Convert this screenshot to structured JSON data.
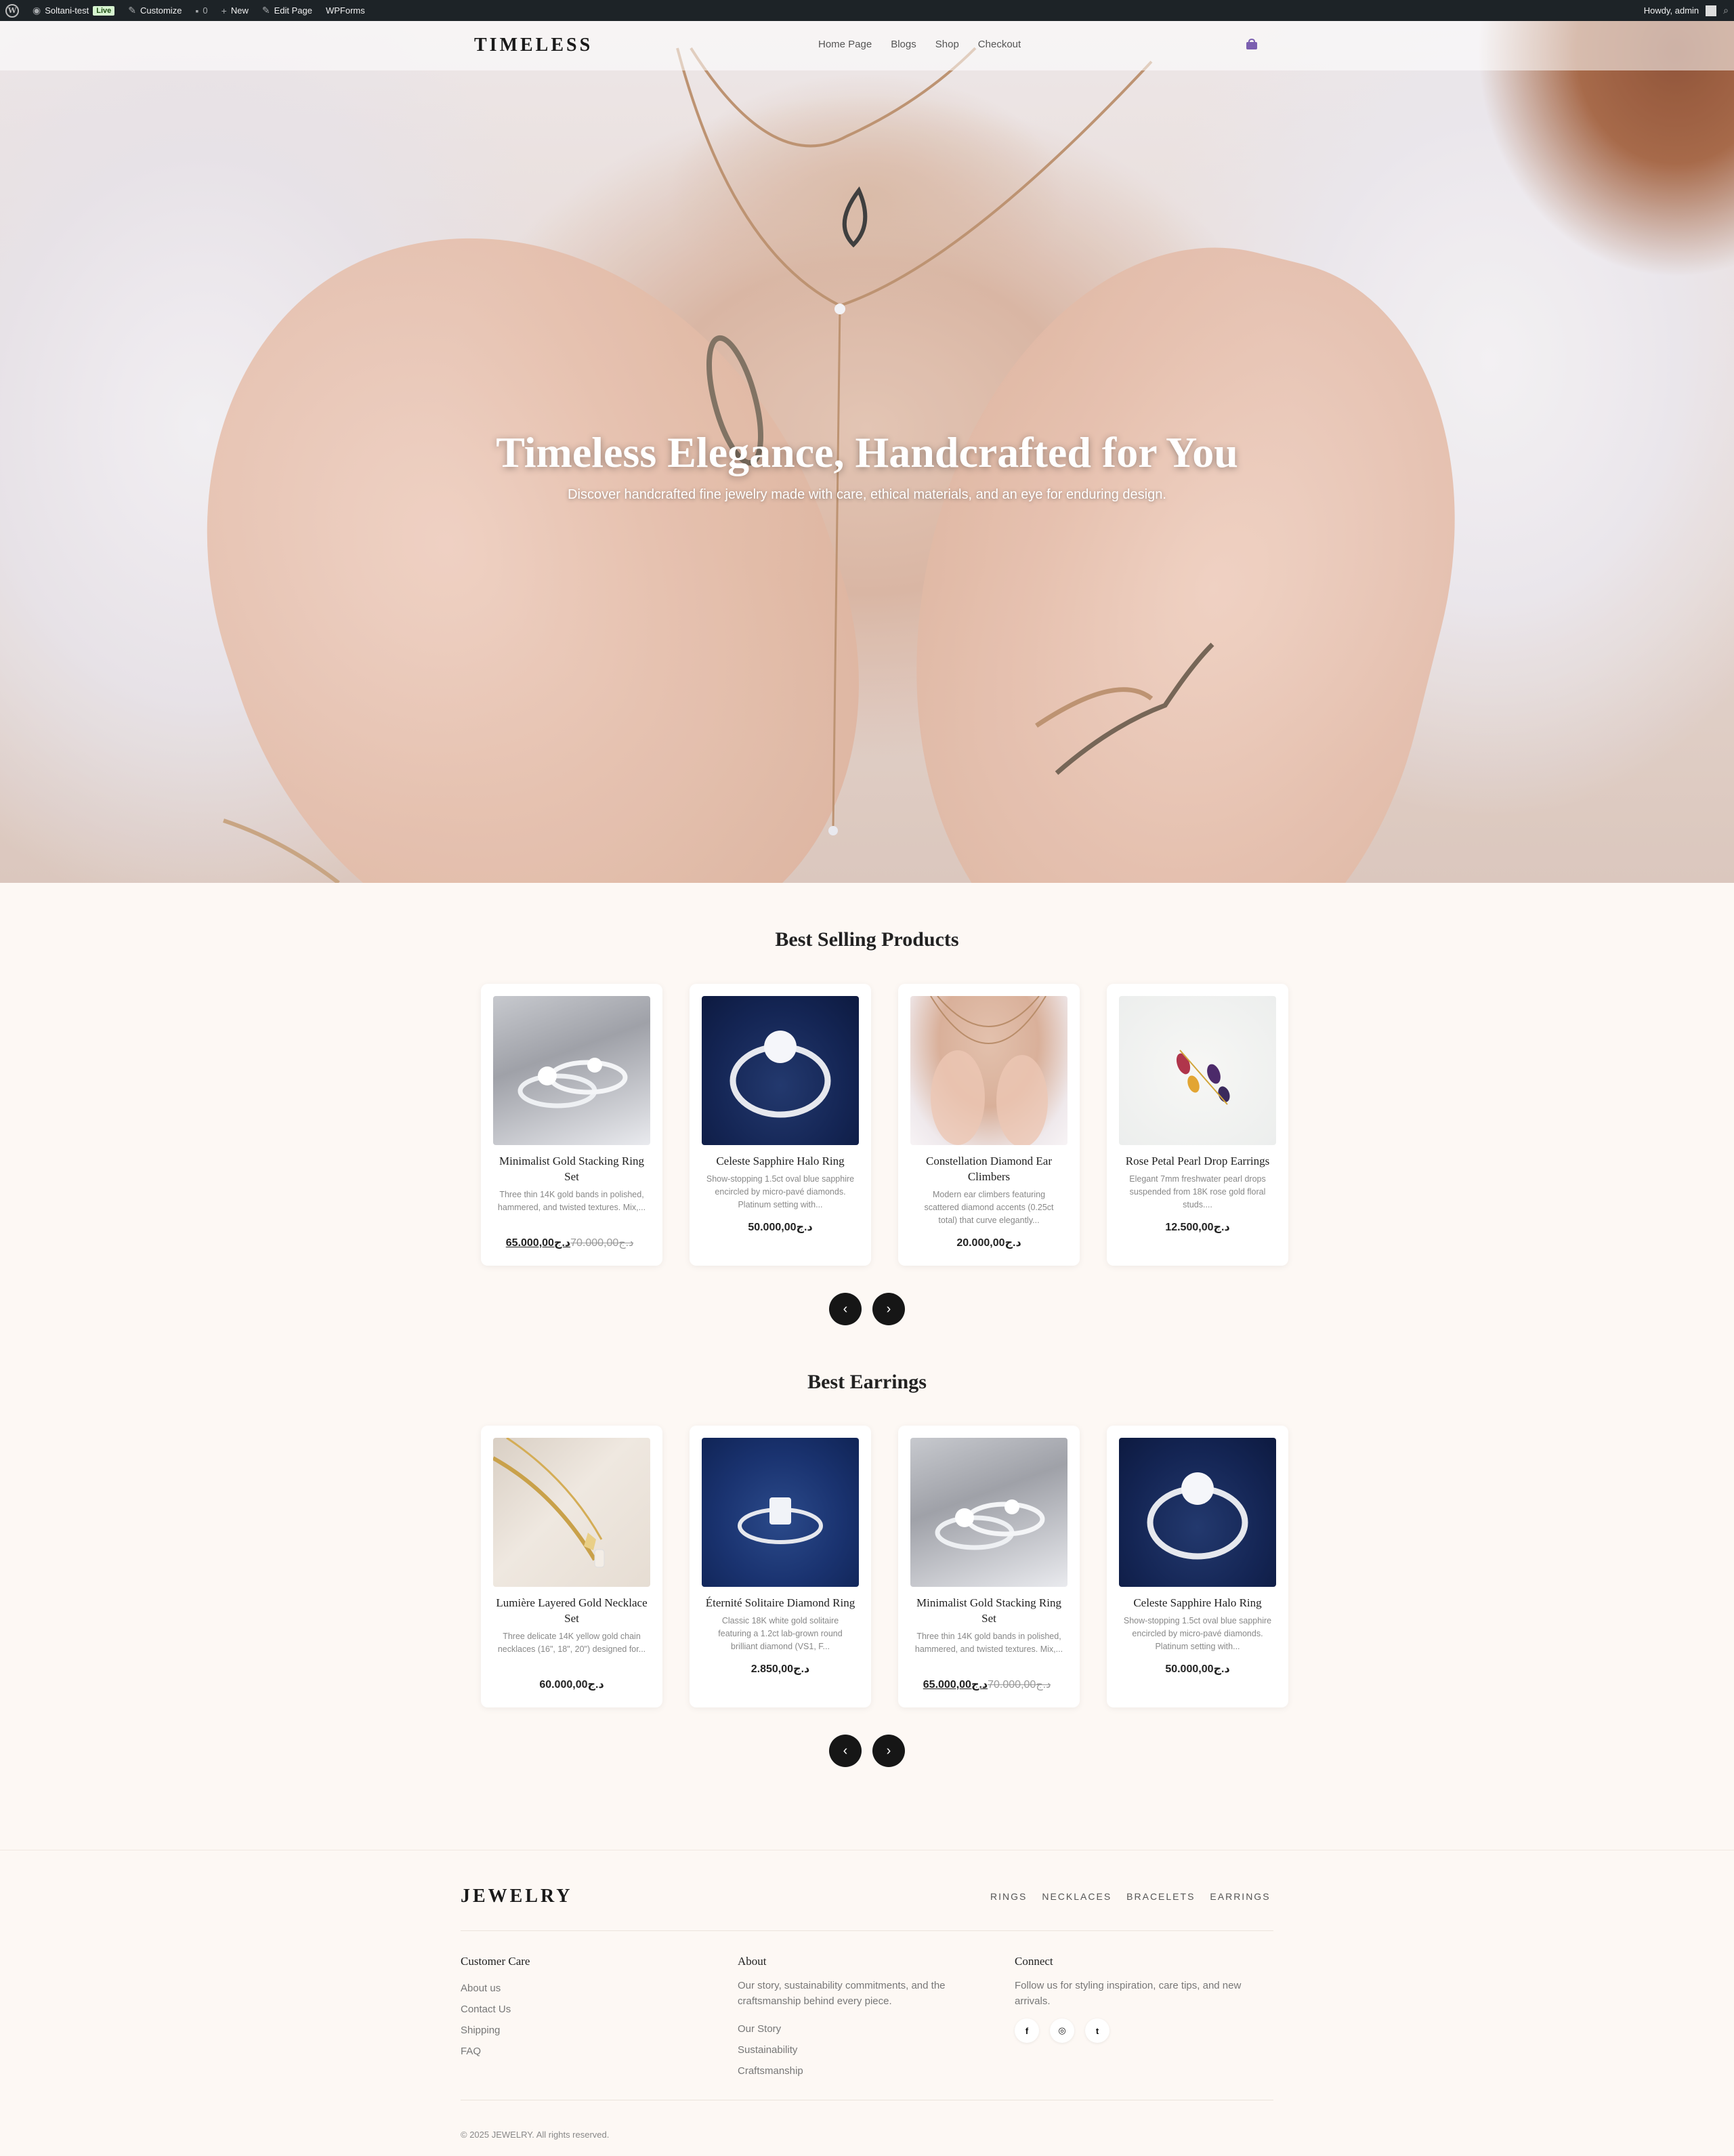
{
  "admin_bar": {
    "site_name": "Soltani-test",
    "live_badge": "Live",
    "customize": "Customize",
    "comments_count": "0",
    "new": "New",
    "edit_page": "Edit Page",
    "wpforms": "WPForms",
    "howdy": "Howdy, admin"
  },
  "header": {
    "logo": "TIMELESS",
    "nav": [
      "Home Page",
      "Blogs",
      "Shop",
      "Checkout"
    ]
  },
  "hero": {
    "title": "Timeless Elegance, Handcrafted for You",
    "subtitle": "Discover handcrafted fine jewelry made with care, ethical materials, and an eye for enduring design."
  },
  "best_selling": {
    "title": "Best Selling Products",
    "products": [
      {
        "name": "Minimalist Gold Stacking Ring Set",
        "desc": "Three thin 14K gold bands in polished, hammered, and twisted textures. Mix,...",
        "old_price": "د.ج70.000,00",
        "price": "د.ج65.000,00"
      },
      {
        "name": "Celeste Sapphire Halo Ring",
        "desc": "Show-stopping 1.5ct oval blue sapphire encircled by micro-pavé diamonds. Platinum setting with...",
        "old_price": "",
        "price": "د.ج50.000,00"
      },
      {
        "name": "Constellation Diamond Ear Climbers",
        "desc": "Modern ear climbers featuring scattered diamond accents (0.25ct total) that curve elegantly...",
        "old_price": "",
        "price": "د.ج20.000,00"
      },
      {
        "name": "Rose Petal Pearl Drop Earrings",
        "desc": "Elegant 7mm freshwater pearl drops suspended from 18K rose gold floral studs....",
        "old_price": "",
        "price": "د.ج12.500,00"
      }
    ]
  },
  "best_earrings": {
    "title": "Best Earrings",
    "products": [
      {
        "name": "Lumière Layered Gold Necklace Set",
        "desc": "Three delicate 14K yellow gold chain necklaces (16\", 18\", 20\") designed for...",
        "old_price": "",
        "price": "د.ج60.000,00"
      },
      {
        "name": "Éternité Solitaire Diamond Ring",
        "desc": "Classic 18K white gold solitaire featuring a 1.2ct lab-grown round brilliant diamond (VS1, F...",
        "old_price": "",
        "price": "د.ج2.850,00"
      },
      {
        "name": "Minimalist Gold Stacking Ring Set",
        "desc": "Three thin 14K gold bands in polished, hammered, and twisted textures. Mix,...",
        "old_price": "د.ج70.000,00",
        "price": "د.ج65.000,00"
      },
      {
        "name": "Celeste Sapphire Halo Ring",
        "desc": "Show-stopping 1.5ct oval blue sapphire encircled by micro-pavé diamonds. Platinum setting with...",
        "old_price": "",
        "price": "د.ج50.000,00"
      }
    ]
  },
  "carousel": {
    "prev": "‹",
    "next": "›"
  },
  "footer": {
    "logo": "JEWELRY",
    "nav": [
      "RINGS",
      "NECKLACES",
      "BRACELETS",
      "EARRINGS"
    ],
    "customer_care": {
      "title": "Customer Care",
      "links": [
        "About us",
        "Contact Us",
        "Shipping",
        "FAQ"
      ]
    },
    "about": {
      "title": "About",
      "text": "Our story, sustainability commitments, and the craftsmanship behind every piece.",
      "links": [
        "Our Story",
        "Sustainability",
        "Craftsmanship"
      ]
    },
    "connect": {
      "title": "Connect",
      "text": "Follow us for styling inspiration, care tips, and new arrivals.",
      "social": [
        "facebook-icon",
        "instagram-icon",
        "twitter-icon"
      ]
    },
    "copyright": "© 2025 JEWELRY. All rights reserved."
  },
  "colors": {
    "background": "#fdf8f4",
    "admin_bar": "#1d2327",
    "arrow_button": "#161616",
    "cart_icon": "#7b5fb0"
  }
}
